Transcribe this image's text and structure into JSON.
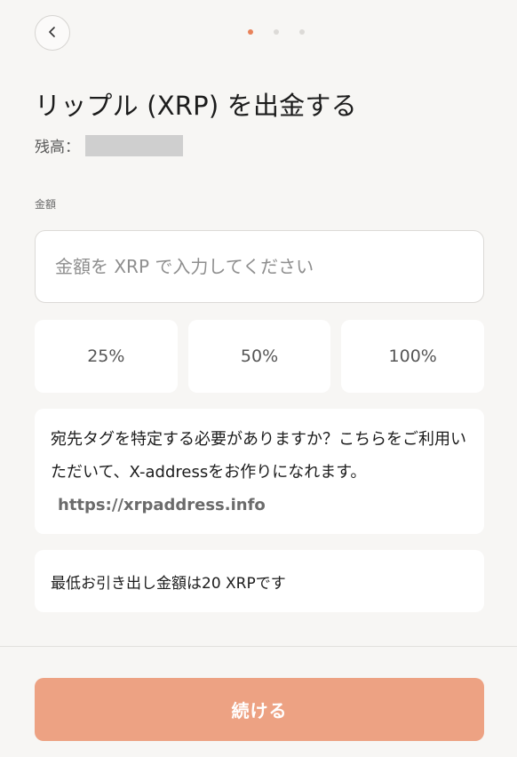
{
  "header": {
    "back_icon": "chevron-left-icon",
    "steps": {
      "total": 3,
      "current": 1
    }
  },
  "title": "リップル (XRP) を出金する",
  "balance": {
    "label": "残高：",
    "value_hidden": true
  },
  "amount": {
    "label": "金額",
    "placeholder": "金額を XRP で入力してください",
    "value": ""
  },
  "percent_buttons": [
    "25%",
    "50%",
    "100%"
  ],
  "info": {
    "text": "宛先タグを特定する必要がありますか？こちらをご利用いただいて、X-addressをお作りになれます。",
    "link": "https://xrpaddress.info"
  },
  "minimum_notice": "最低お引き出し金額は20 XRPです",
  "continue_label": "続ける",
  "colors": {
    "accent": "#e8825a",
    "button_disabled": "#eda283",
    "background": "#f7f6f4"
  }
}
